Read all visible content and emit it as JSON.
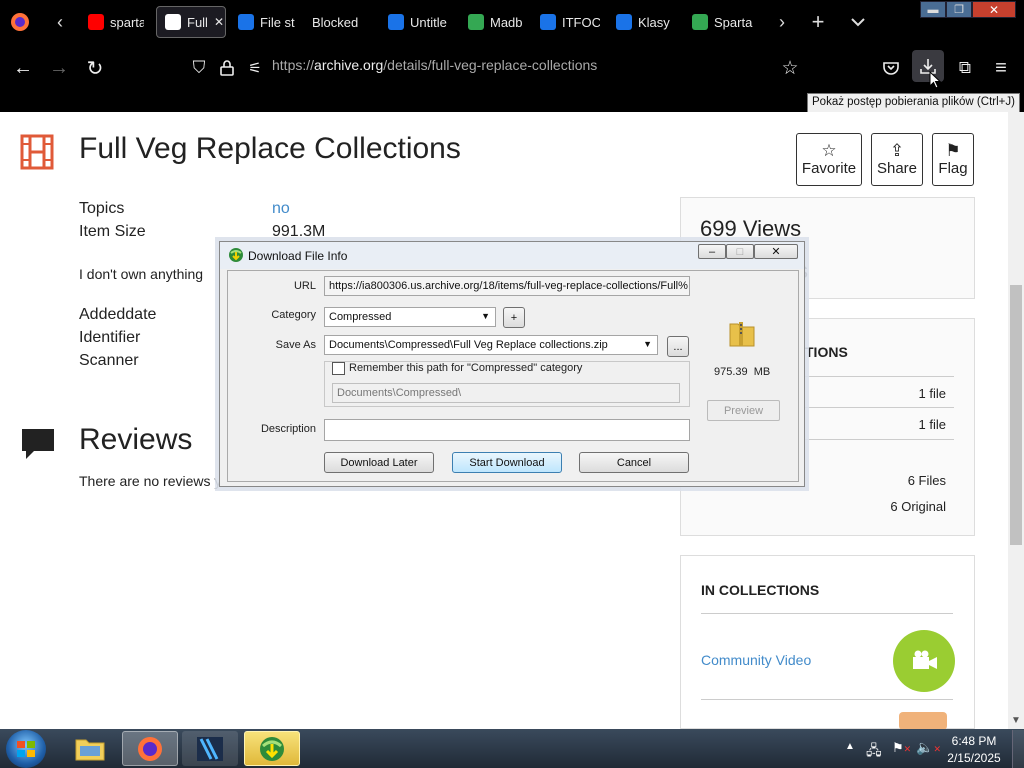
{
  "browser": {
    "tabs": [
      {
        "label": "sparta",
        "color": "#ff0000"
      },
      {
        "label": "Full",
        "color": "#ffffff",
        "active": true
      },
      {
        "label": "File st",
        "color": "#1a73e8"
      },
      {
        "label": "Blocked",
        "color": "#000000"
      },
      {
        "label": "Untitle",
        "color": "#1a73e8"
      },
      {
        "label": "Madb",
        "color": "#34a853"
      },
      {
        "label": "ITFOC",
        "color": "#1a73e8"
      },
      {
        "label": "Klasy",
        "color": "#1a73e8"
      },
      {
        "label": "Sparta",
        "color": "#34a853"
      }
    ],
    "url_prefix": "https://",
    "url_domain": "archive.org",
    "url_path": "/details/full-veg-replace-collections",
    "tooltip": "Pokaż postęp pobierania plików (Ctrl+J)"
  },
  "page": {
    "title": "Full Veg Replace Collections",
    "topics_label": "Topics",
    "topics_value": "no",
    "size_label": "Item Size",
    "size_value": "991.3M",
    "description": "I don't own anything",
    "addeddate_label": "Addeddate",
    "identifier_label": "Identifier",
    "scanner_label": "Scanner",
    "reviews_title": "Reviews",
    "reviews_text": "There are no reviews y",
    "favorite": "Favorite",
    "share": "Share",
    "flag": "Flag",
    "views": "699 Views",
    "views_tail": "s",
    "options_heading": "TIONS",
    "file_rows": [
      "1 file",
      "1 file"
    ],
    "files_total": "6 Files",
    "files_original": "6 Original",
    "collections_heading": "IN COLLECTIONS",
    "collection_link": "Community Video"
  },
  "dialog": {
    "title": "Download File Info",
    "url_label": "URL",
    "url_value": "https://ia800306.us.archive.org/18/items/full-veg-replace-collections/Full%",
    "category_label": "Category",
    "category_value": "Compressed",
    "saveas_label": "Save As",
    "saveas_value": "Documents\\Compressed\\Full Veg Replace collections.zip",
    "remember_label": "Remember this path for \"Compressed\" category",
    "path_value": "Documents\\Compressed\\",
    "description_label": "Description",
    "size": "975.39  MB",
    "preview": "Preview",
    "download_later": "Download Later",
    "start_download": "Start Download",
    "cancel": "Cancel",
    "browse": "...",
    "add": "+"
  },
  "taskbar": {
    "time": "6:48 PM",
    "date": "2/15/2025"
  }
}
